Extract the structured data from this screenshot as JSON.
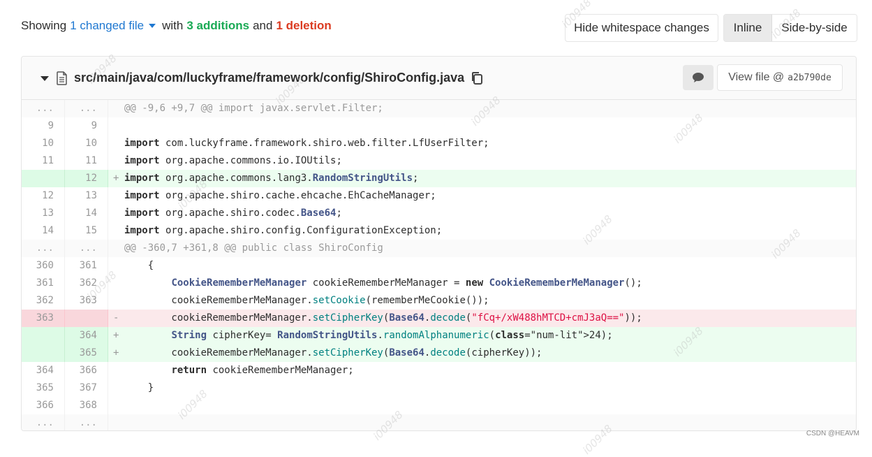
{
  "summary": {
    "showing": "Showing",
    "changed_files": "1 changed file",
    "with": "with",
    "additions": "3 additions",
    "and": "and",
    "deletions": "1 deletion"
  },
  "toolbar": {
    "hide_whitespace": "Hide whitespace changes",
    "inline": "Inline",
    "side_by_side": "Side-by-side"
  },
  "file": {
    "path": "src/main/java/com/luckyframe/framework/config/ShiroConfig.java",
    "view_file_label": "View file @",
    "sha": "a2b790de"
  },
  "diff_rows": [
    {
      "type": "match",
      "old": "...",
      "new": "...",
      "sign": "",
      "text": "@@ -9,6 +9,7 @@ import javax.servlet.Filter;"
    },
    {
      "type": "ctx",
      "old": "9",
      "new": "9",
      "sign": "",
      "text": ""
    },
    {
      "type": "ctx",
      "old": "10",
      "new": "10",
      "sign": "",
      "text": "import com.luckyframe.framework.shiro.web.filter.LfUserFilter;"
    },
    {
      "type": "ctx",
      "old": "11",
      "new": "11",
      "sign": "",
      "text": "import org.apache.commons.io.IOUtils;"
    },
    {
      "type": "add",
      "old": "",
      "new": "12",
      "sign": "+",
      "text": "import org.apache.commons.lang3.RandomStringUtils;"
    },
    {
      "type": "ctx",
      "old": "12",
      "new": "13",
      "sign": "",
      "text": "import org.apache.shiro.cache.ehcache.EhCacheManager;"
    },
    {
      "type": "ctx",
      "old": "13",
      "new": "14",
      "sign": "",
      "text": "import org.apache.shiro.codec.Base64;"
    },
    {
      "type": "ctx",
      "old": "14",
      "new": "15",
      "sign": "",
      "text": "import org.apache.shiro.config.ConfigurationException;"
    },
    {
      "type": "match",
      "old": "...",
      "new": "...",
      "sign": "",
      "text": "@@ -360,7 +361,8 @@ public class ShiroConfig"
    },
    {
      "type": "ctx",
      "old": "360",
      "new": "361",
      "sign": "",
      "text": "    {"
    },
    {
      "type": "ctx",
      "old": "361",
      "new": "362",
      "sign": "",
      "text": "        CookieRememberMeManager cookieRememberMeManager = new CookieRememberMeManager();"
    },
    {
      "type": "ctx",
      "old": "362",
      "new": "363",
      "sign": "",
      "text": "        cookieRememberMeManager.setCookie(rememberMeCookie());"
    },
    {
      "type": "del",
      "old": "363",
      "new": "",
      "sign": "-",
      "text": "        cookieRememberMeManager.setCipherKey(Base64.decode(\"fCq+/xW488hMTCD+cmJ3aQ==\"));"
    },
    {
      "type": "add",
      "old": "",
      "new": "364",
      "sign": "+",
      "text": "        String cipherKey= RandomStringUtils.randomAlphanumeric(24);"
    },
    {
      "type": "add",
      "old": "",
      "new": "365",
      "sign": "+",
      "text": "        cookieRememberMeManager.setCipherKey(Base64.decode(cipherKey));"
    },
    {
      "type": "ctx",
      "old": "364",
      "new": "366",
      "sign": "",
      "text": "        return cookieRememberMeManager;"
    },
    {
      "type": "ctx",
      "old": "365",
      "new": "367",
      "sign": "",
      "text": "    }"
    },
    {
      "type": "ctx",
      "old": "366",
      "new": "368",
      "sign": "",
      "text": ""
    },
    {
      "type": "match",
      "old": "...",
      "new": "...",
      "sign": "",
      "text": ""
    }
  ],
  "watermark_text": "i00948",
  "credit": "CSDN @HEAVM",
  "colors": {
    "link": "#1f78d1",
    "addition": "#1aaa55",
    "deletion": "#db3b21",
    "added_line_bg": "#ecfdf0",
    "deleted_line_bg": "#fbe9eb"
  }
}
